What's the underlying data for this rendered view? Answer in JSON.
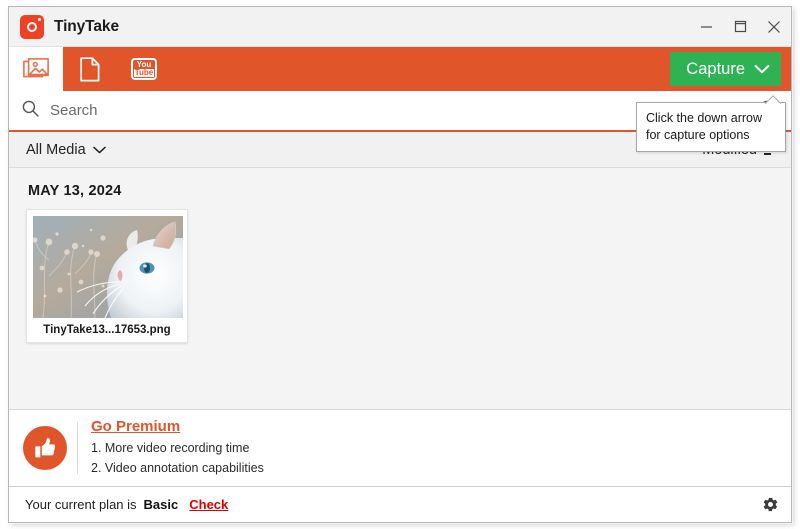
{
  "window": {
    "title": "TinyTake",
    "app_icon": "camera-icon",
    "controls": {
      "minimize": "minimize-icon",
      "maximize": "maximize-icon",
      "close": "close-icon"
    }
  },
  "toolbar": {
    "tabs": [
      {
        "name": "images",
        "icon": "image-gallery-icon",
        "active": true
      },
      {
        "name": "files",
        "icon": "document-icon",
        "active": false
      },
      {
        "name": "youtube",
        "icon": "youtube-icon",
        "label_top": "You",
        "label_bottom": "Tube",
        "active": false
      }
    ],
    "capture": {
      "label": "Capture",
      "chevron": "chevron-down-icon",
      "color": "#2eb254"
    },
    "background_color": "#e1552a"
  },
  "search": {
    "icon": "search-icon",
    "placeholder": "Search",
    "value": "",
    "underline_color": "#e1552a"
  },
  "filters": {
    "media_filter": {
      "label": "All Media",
      "chevron": "chevron-down-icon"
    },
    "sort": {
      "label": "Modified",
      "icon": "sort-icon"
    }
  },
  "tooltip": {
    "line1": "Click the down arrow",
    "line2": "for capture options"
  },
  "media": {
    "date_header": "MAY 13, 2024",
    "items": [
      {
        "filename": "TinyTake13...17653.png",
        "thumbnail": "white-cat-photo"
      }
    ]
  },
  "premium": {
    "icon": "thumbs-up-icon",
    "title": "Go Premium",
    "benefits": [
      "1. More video recording time",
      "2. Video annotation capabilities"
    ],
    "accent_color": "#e1552a"
  },
  "status": {
    "text": "Your current plan is",
    "plan": "Basic",
    "check_label": "Check",
    "check_color": "#e00000",
    "settings_icon": "gear-icon"
  }
}
